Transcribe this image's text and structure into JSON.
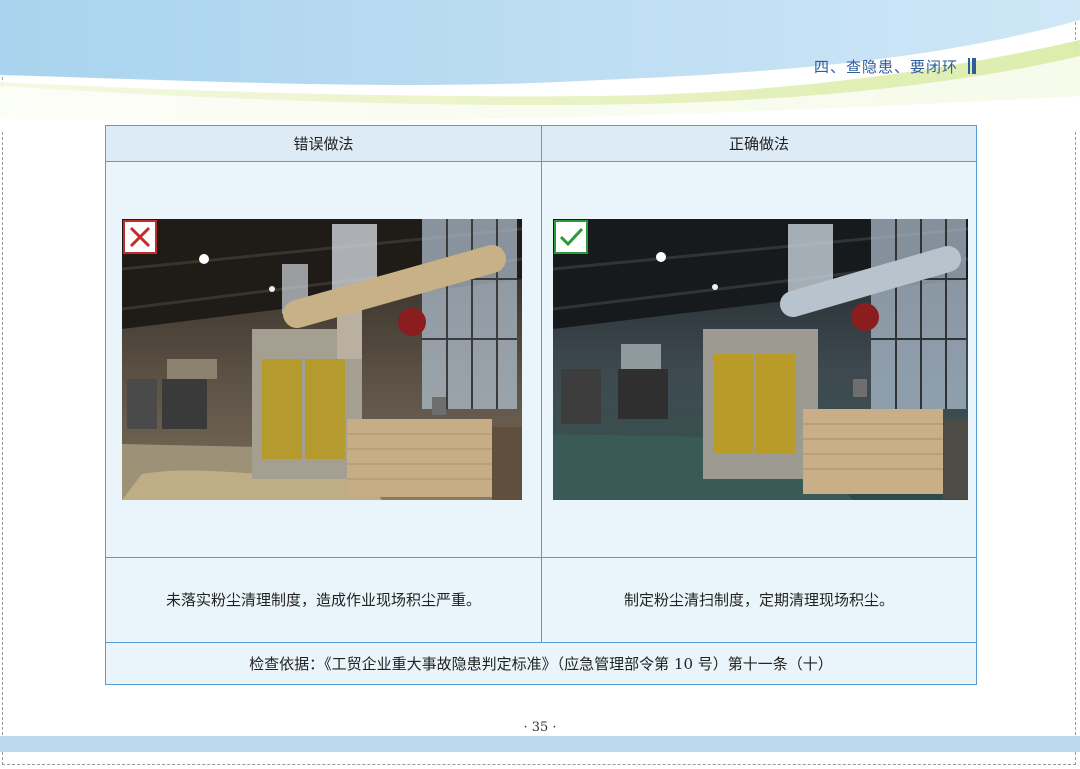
{
  "header": {
    "section_title": "四、查隐患、要闭环"
  },
  "table": {
    "columns": {
      "wrong": "错误做法",
      "right": "正确做法"
    },
    "wrong": {
      "mark_icon": "x-mark-icon",
      "mark_color": "#c42a2a",
      "description": "未落实粉尘清理制度，造成作业现场积尘严重。"
    },
    "right": {
      "mark_icon": "check-mark-icon",
      "mark_color": "#2a9a3a",
      "description": "制定粉尘清扫制度，定期清理现场积尘。"
    },
    "basis": "检查依据：《工贸企业重大事故隐患判定标准》（应急管理部令第 10 号）第十一条（十）"
  },
  "footer": {
    "page_number": "· 35 ·"
  }
}
